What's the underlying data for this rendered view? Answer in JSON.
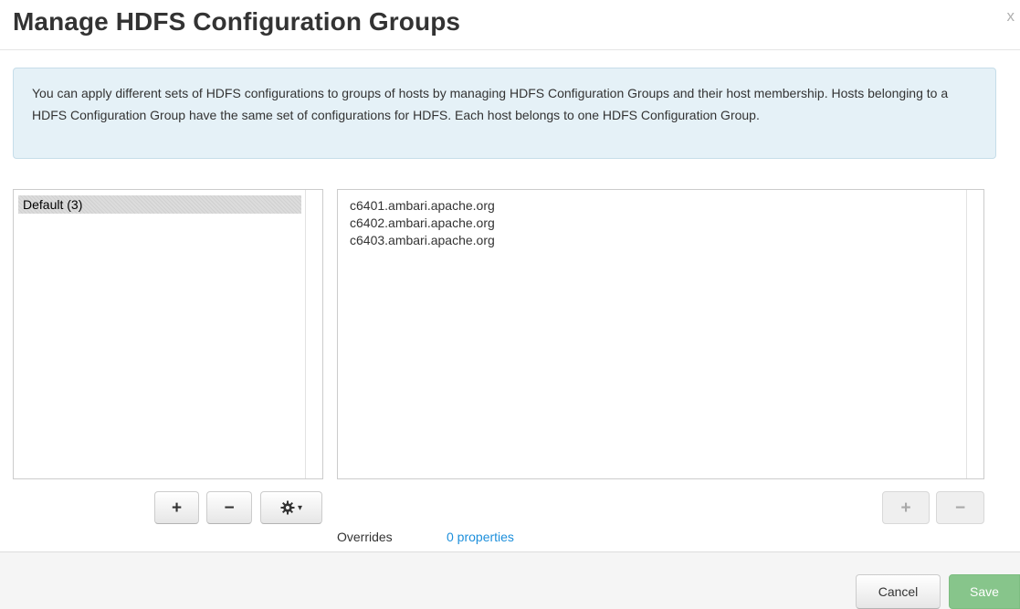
{
  "dialog": {
    "title": "Manage HDFS Configuration Groups",
    "close_label": "x"
  },
  "info": {
    "text": "You can apply different sets of HDFS configurations to groups of hosts by managing HDFS Configuration Groups and their host membership. Hosts belonging to a HDFS Configuration Group have the same set of configurations for HDFS. Each host belongs to one HDFS Configuration Group."
  },
  "groups": {
    "items": [
      {
        "label": "Default (3)",
        "selected": true
      }
    ],
    "add_label": "+",
    "remove_label": "−",
    "settings_icon": "gear-icon",
    "settings_caret": "▾"
  },
  "hosts": {
    "items": [
      "c6401.ambari.apache.org",
      "c6402.ambari.apache.org",
      "c6403.ambari.apache.org"
    ],
    "add_label": "+",
    "remove_label": "−"
  },
  "overrides": {
    "label": "Overrides",
    "value": "0 properties"
  },
  "footer": {
    "cancel_label": "Cancel",
    "save_label": "Save"
  },
  "colors": {
    "info_bg": "#e5f1f7",
    "link": "#1d8fdb",
    "save_bg": "#87c58b",
    "footer_bg": "#f5f5f5"
  }
}
